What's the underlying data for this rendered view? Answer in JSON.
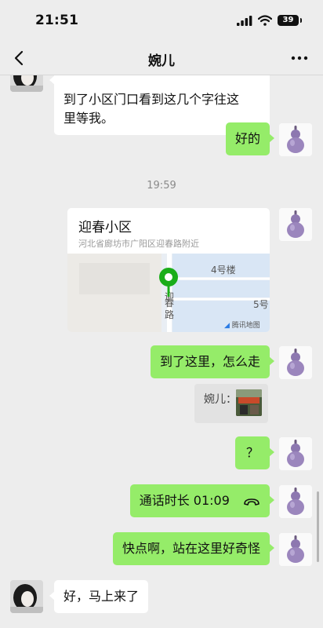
{
  "status": {
    "time": "21:51",
    "battery": "39"
  },
  "nav": {
    "title": "婉儿"
  },
  "messages": {
    "m1": "到了小区门口看到这几个字往这\n里等我。",
    "m2": "好的",
    "timestamp": "19:59",
    "location": {
      "name": "迎春小区",
      "address": "河北省廊坊市广阳区迎春路附近",
      "map_building": "4号楼",
      "map_building2": "5号",
      "map_road": "春\n路",
      "map_road_top": "迎",
      "map_brand": "腾讯地图"
    },
    "m3": "到了这里，怎么走",
    "quote_label": "婉儿：",
    "m4": "？",
    "m5_call": "通话时长 01:09",
    "m6": "快点啊，站在这里好奇怪",
    "m7": "好，马上来了"
  },
  "colors": {
    "outgoing": "#95ec69",
    "incoming": "#ffffff",
    "background": "#ededed",
    "pin": "#1aad19"
  }
}
